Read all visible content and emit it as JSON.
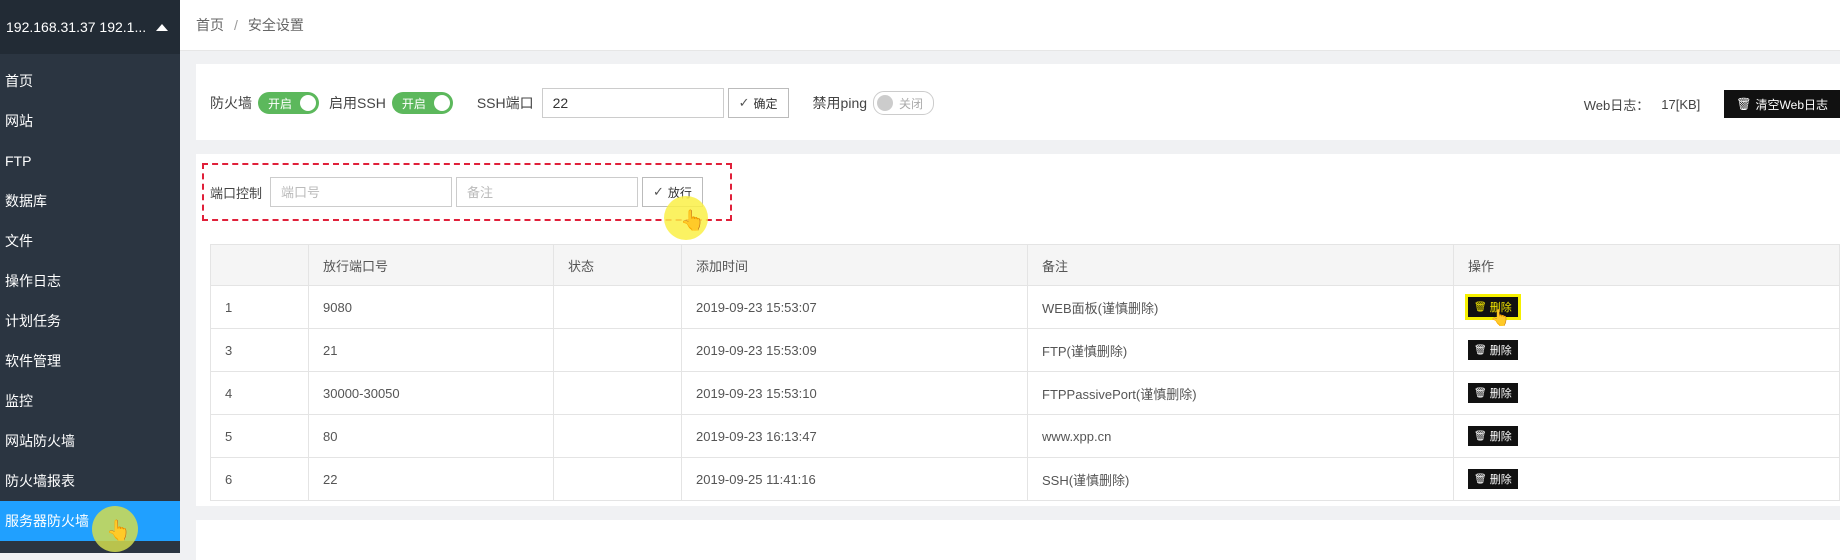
{
  "sidebar": {
    "server": "192.168.31.37 192.1...",
    "items": [
      {
        "label": "首页"
      },
      {
        "label": "网站"
      },
      {
        "label": "FTP"
      },
      {
        "label": "数据库"
      },
      {
        "label": "文件"
      },
      {
        "label": "操作日志"
      },
      {
        "label": "计划任务"
      },
      {
        "label": "软件管理"
      },
      {
        "label": "监控"
      },
      {
        "label": "网站防火墙"
      },
      {
        "label": "防火墙报表"
      },
      {
        "label": "服务器防火墙"
      }
    ]
  },
  "breadcrumb": {
    "home": "首页",
    "sep": "/",
    "current": "安全设置"
  },
  "security": {
    "firewall_label": "防火墙",
    "firewall_state": "开启",
    "ssh_label": "启用SSH",
    "ssh_state": "开启",
    "ssh_port_label": "SSH端口",
    "ssh_port_value": "22",
    "confirm_label": "确定",
    "ping_label": "禁用ping",
    "ping_state": "关闭",
    "weblog_label": "Web日志：",
    "weblog_size": "17[KB]",
    "clear_weblog": "清空Web日志"
  },
  "port_control": {
    "label": "端口控制",
    "port_placeholder": "端口号",
    "note_placeholder": "备注",
    "allow_label": "放行"
  },
  "table": {
    "headers": [
      "",
      "放行端口号",
      "状态",
      "添加时间",
      "备注",
      "操作"
    ],
    "delete_label": "删除",
    "rows": [
      {
        "id": "1",
        "port": "9080",
        "status": "",
        "time": "2019-09-23 15:53:07",
        "note": "WEB面板(谨慎删除)"
      },
      {
        "id": "3",
        "port": "21",
        "status": "",
        "time": "2019-09-23 15:53:09",
        "note": "FTP(谨慎删除)"
      },
      {
        "id": "4",
        "port": "30000-30050",
        "status": "",
        "time": "2019-09-23 15:53:10",
        "note": "FTPPassivePort(谨慎删除)"
      },
      {
        "id": "5",
        "port": "80",
        "status": "",
        "time": "2019-09-23 16:13:47",
        "note": "www.xpp.cn"
      },
      {
        "id": "6",
        "port": "22",
        "status": "",
        "time": "2019-09-25 11:41:16",
        "note": "SSH(谨慎删除)"
      }
    ]
  },
  "colors": {
    "sidebar_bg": "#2b3541",
    "active": "#20a0ff",
    "toggle_on": "#5cb85c",
    "highlight": "#f5f000",
    "dashed_border": "#e0203a"
  }
}
